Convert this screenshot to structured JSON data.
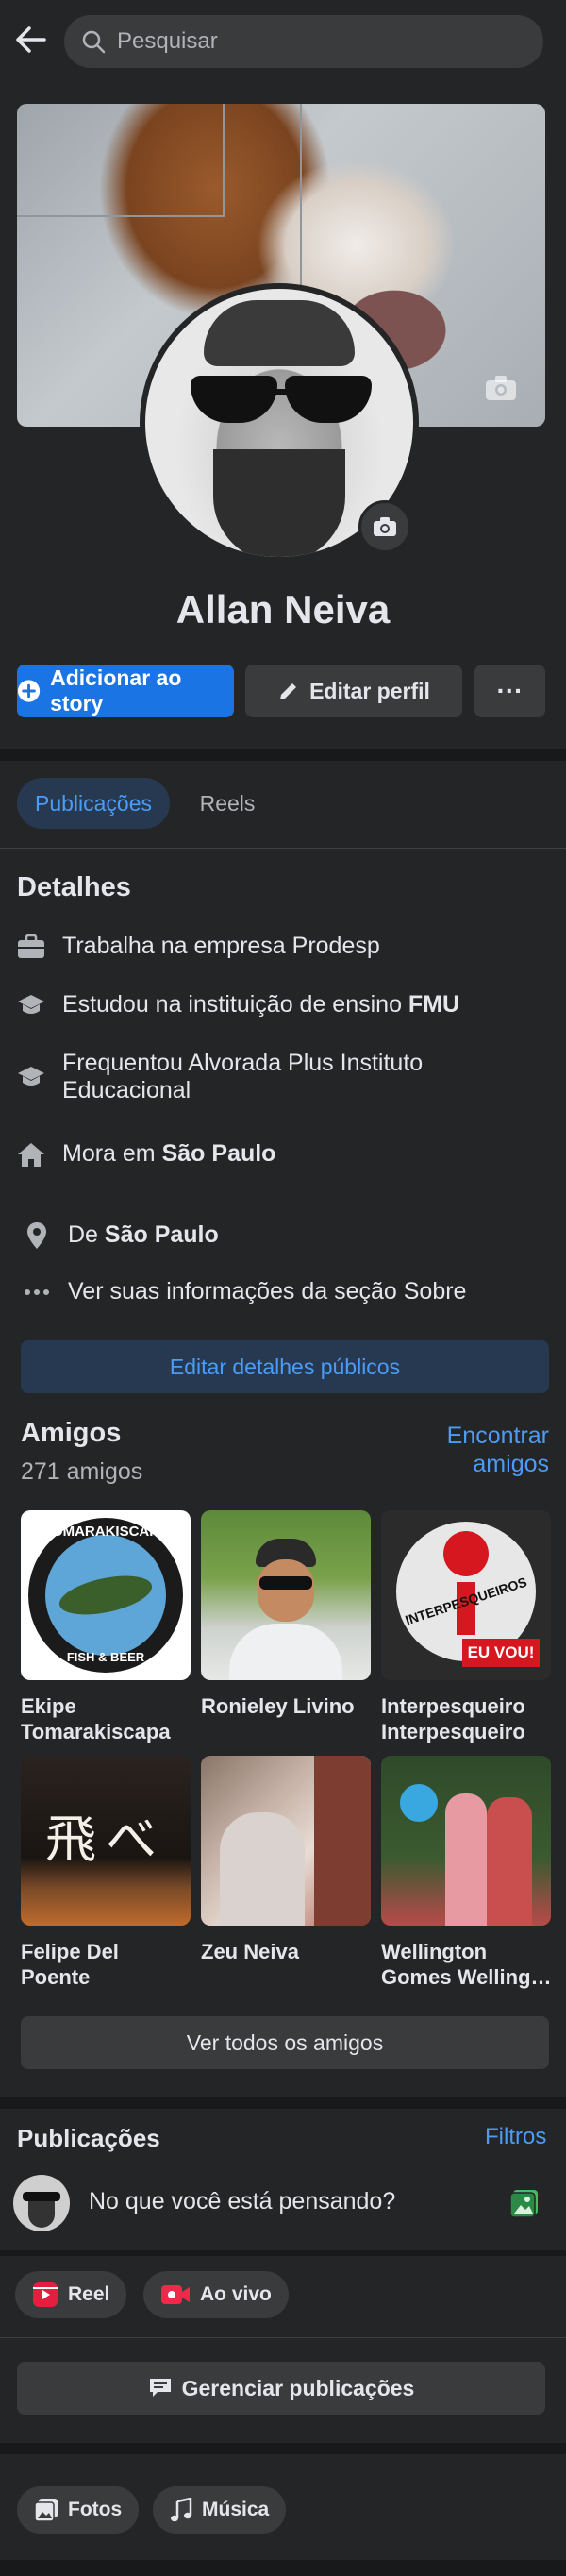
{
  "header": {
    "search_placeholder": "Pesquisar"
  },
  "profile": {
    "name": "Allan Neiva"
  },
  "actions": {
    "add_story": "Adicionar ao story",
    "edit_profile": "Editar perfil",
    "more": "···"
  },
  "tabs": [
    {
      "label": "Publicações"
    },
    {
      "label": "Reels"
    }
  ],
  "details": {
    "title": "Detalhes",
    "work": "Trabalha na empresa Prodesp",
    "study_prefix": "Estudou na instituição de ensino ",
    "study_bold": "FMU",
    "attended": "Frequentou Alvorada Plus Instituto Educacional",
    "lives_prefix": "Mora em ",
    "lives_bold": "São Paulo",
    "from_prefix": "De ",
    "from_bold": "São Paulo",
    "about_link": "Ver suas informações da seção Sobre",
    "edit_button": "Editar detalhes públicos"
  },
  "friends": {
    "title": "Amigos",
    "count": "271 amigos",
    "find": "Encontrar amigos",
    "list": [
      {
        "name": "Ekipe Tomarakiscapa",
        "logo_top": "TOMARAKISCAPA",
        "logo_bottom": "FISH & BEER"
      },
      {
        "name": "Ronieley Livino"
      },
      {
        "name": "Interpesqueiro Interpesqueiro",
        "logo_text": "INTERPESQUEIROS",
        "logo_badge": "EU VOU!"
      },
      {
        "name": "Felipe Del Poente",
        "glyphs": "飛べ"
      },
      {
        "name": "Zeu Neiva"
      },
      {
        "name": "Wellington Gomes Welling…"
      }
    ],
    "see_all": "Ver todos os amigos"
  },
  "posts": {
    "title": "Publicações",
    "filters": "Filtros",
    "composer_placeholder": "No que você está pensando?",
    "reel": "Reel",
    "live": "Ao vivo",
    "manage": "Gerenciar publicações"
  },
  "bottom": {
    "photos": "Fotos",
    "music": "Música"
  }
}
